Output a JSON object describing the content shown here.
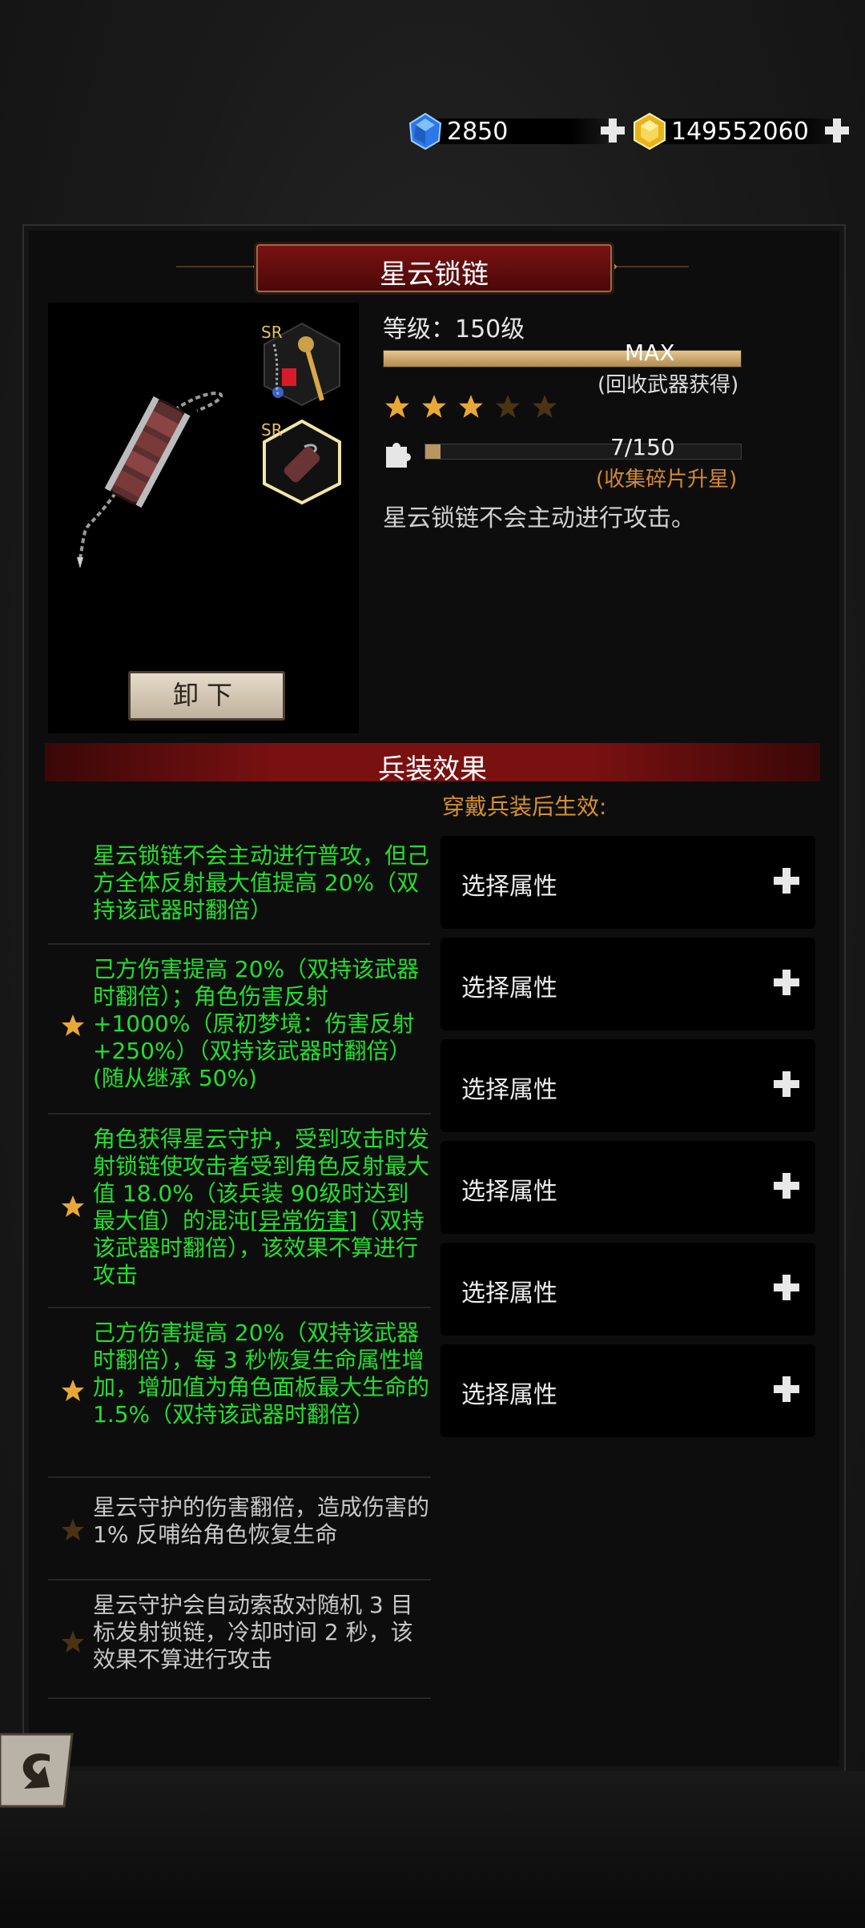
{
  "currency": {
    "gems": "2850",
    "gold": "149552060"
  },
  "weapon": {
    "title": "星云锁链",
    "level_text": "等级：150级",
    "level_bar_label": "MAX",
    "level_progress": 1.0,
    "recycle_hint": "(回收武器获得)",
    "stars_filled": 3,
    "stars_total": 5,
    "fragment_count": "7/150",
    "fragment_progress": 0.047,
    "fragment_hint": "(收集碎片升星)",
    "description": "星云锁链不会主动进行攻击。",
    "unequip_label": "卸下",
    "badge_sr": "SR"
  },
  "section": {
    "title": "兵装效果",
    "equip_hint": "穿戴兵装后生效:"
  },
  "effects": [
    {
      "text": "星云锁链不会主动进行普攻，但己方全体反射最大值提高 20%（双持该武器时翻倍）",
      "active": true,
      "star": false
    },
    {
      "text": "己方伤害提高 20%（双持该武器时翻倍）；角色伤害反射 +1000%（原初梦境：伤害反射 +250%）（双持该武器时翻倍）(随从继承 50%)",
      "active": true,
      "star": true
    },
    {
      "text_a": "角色获得星云守护，受到攻击时发射锁链使攻击者受到角色反射最大值 18.0%（该兵装 90级时达到最大值）的混沌[",
      "text_link": "异常伤害",
      "text_b": "]（双持该武器时翻倍），该效果不算进行攻击",
      "active": true,
      "star": true
    },
    {
      "text": "己方伤害提高 20%（双持该武器时翻倍），每 3 秒恢复生命属性增加，增加值为角色面板最大生命的 1.5%（双持该武器时翻倍）",
      "active": true,
      "star": true
    },
    {
      "text": "星云守护的伤害翻倍，造成伤害的 1% 反哺给角色恢复生命",
      "active": false,
      "star": true
    },
    {
      "text": "星云守护会自动索敌对随机 3 目标发射锁链，冷却时间 2 秒，该效果不算进行攻击",
      "active": false,
      "star": true
    }
  ],
  "slots": [
    {
      "label": "选择属性"
    },
    {
      "label": "选择属性"
    },
    {
      "label": "选择属性"
    },
    {
      "label": "选择属性"
    },
    {
      "label": "选择属性"
    },
    {
      "label": "选择属性"
    }
  ],
  "colors": {
    "active_effect": "#22e02a",
    "inactive_effect": "#c8c8c8",
    "hint_orange": "#d8902e",
    "title_red": "#7a1212",
    "star_gold": "#e8a838"
  }
}
